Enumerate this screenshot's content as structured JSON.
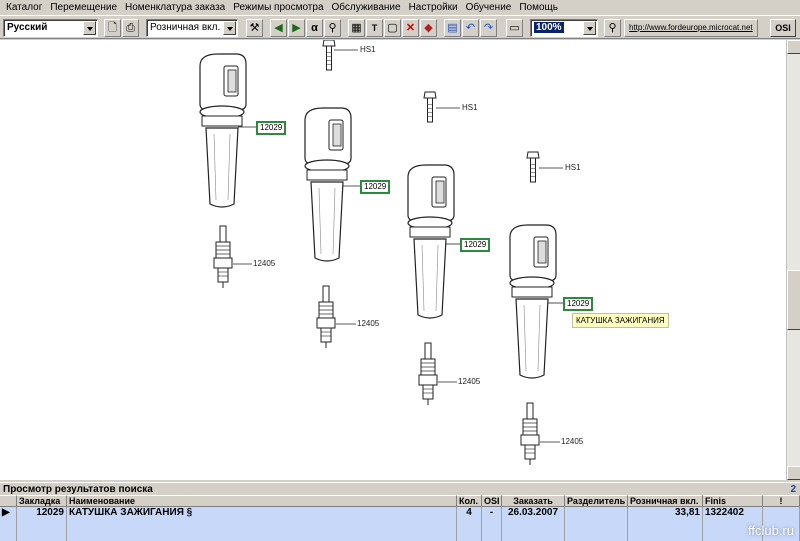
{
  "menu": [
    "Каталог",
    "Перемещение",
    "Номенклатура заказа",
    "Режимы просмотра",
    "Обслуживание",
    "Настройки",
    "Обучение",
    "Помощь"
  ],
  "toolbar": {
    "language": "Русский",
    "price_mode": "Розничная вкл.",
    "zoom": "100%",
    "url": "http://www.fordeurope.microcat.net",
    "osi_label": "OSI"
  },
  "diagram": {
    "coil_callout": "12029",
    "plug_callout": "12405",
    "bolt_callout": "HS1",
    "tooltip": "КАТУШКА ЗАЖИГАНИЯ"
  },
  "results": {
    "title": "Просмотр результатов поиска",
    "count": "2",
    "columns": [
      "Закладка",
      "Наименование",
      "Кол.",
      "OSI",
      "Заказать",
      "Разделитель",
      "Розничная вкл.",
      "Finis",
      "!"
    ],
    "rows": [
      {
        "bookmark": "12029",
        "name": "КАТУШКА ЗАЖИГАНИЯ §",
        "qty": "4",
        "osi": "-",
        "order": "26.03.2007",
        "separator": "",
        "price": "33,81",
        "finis": "1322402",
        "flag": ""
      }
    ]
  },
  "watermark": "ffclub.ru"
}
